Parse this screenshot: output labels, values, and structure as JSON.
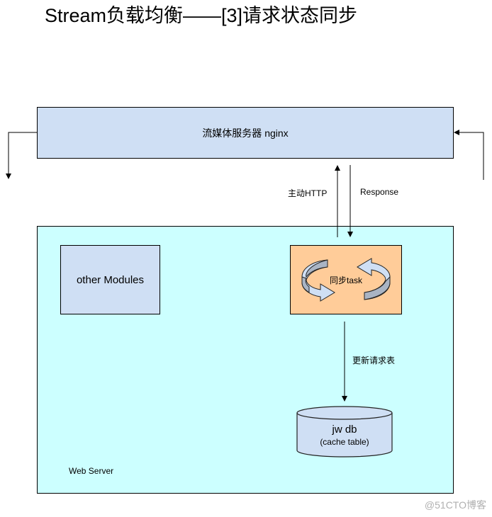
{
  "title": "Stream负载均衡——[3]请求状态同步",
  "nodes": {
    "nginx": {
      "label": "流媒体服务器 nginx"
    },
    "web_server": {
      "label": "Web Server"
    },
    "other_modules": {
      "label": "other Modules"
    },
    "sync_task": {
      "label": "同步task",
      "icon": "circular-sync-arrows-icon"
    },
    "database": {
      "label": "jw db",
      "sublabel": "(cache table)"
    }
  },
  "edges": {
    "active_http": {
      "label": "主动HTTP",
      "from": "sync_task",
      "to": "nginx"
    },
    "response": {
      "label": "Response",
      "from": "nginx",
      "to": "sync_task"
    },
    "update_table": {
      "label": "更新请求表",
      "from": "sync_task",
      "to": "database"
    },
    "nginx_out_left": {
      "label": "",
      "from": "nginx",
      "to": "external"
    },
    "nginx_in_right": {
      "label": "",
      "from": "external",
      "to": "nginx"
    }
  },
  "colors": {
    "nginx_fill": "#cfdff4",
    "web_server_fill": "#ccffff",
    "modules_fill": "#cfdff4",
    "task_fill": "#ffcc99",
    "db_fill": "#cfdff4"
  },
  "watermark": "@51CTO博客"
}
